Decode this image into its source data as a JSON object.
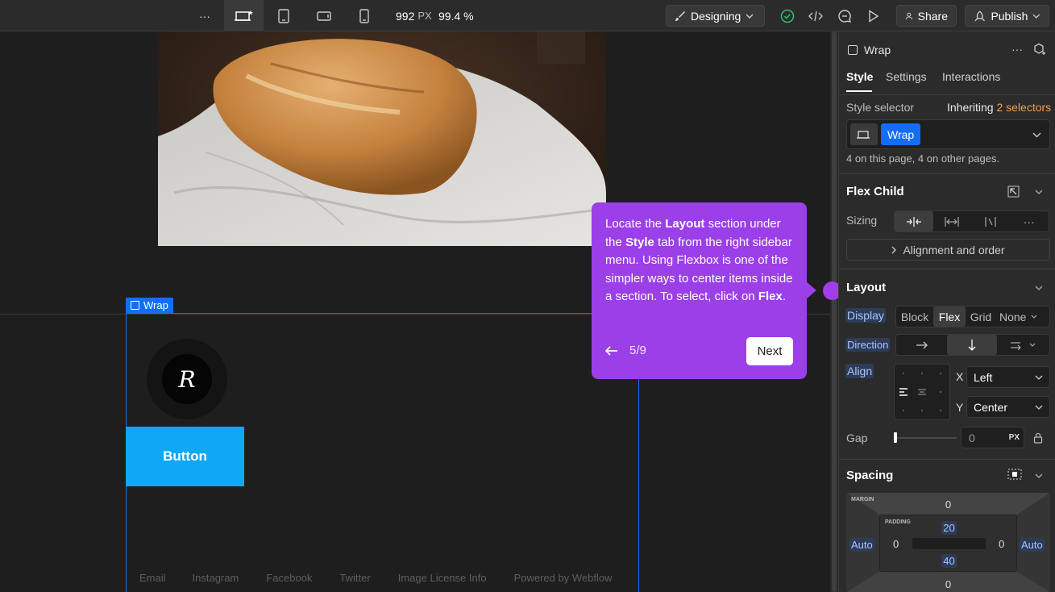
{
  "topbar": {
    "more_label": "···",
    "width_value": "992",
    "width_unit": "PX",
    "zoom": "99.4 %",
    "mode_label": "Designing",
    "share_label": "Share",
    "publish_label": "Publish"
  },
  "canvas": {
    "wrap_tag": "Wrap",
    "logo_letter": "R",
    "button_label": "Button",
    "footer_links": [
      "Email",
      "Instagram",
      "Facebook",
      "Twitter",
      "Image License Info",
      "Powered by Webflow"
    ]
  },
  "tooltip": {
    "text_parts": [
      {
        "t": "Locate the ",
        "b": false
      },
      {
        "t": "Layout",
        "b": true
      },
      {
        "t": " section under the ",
        "b": false
      },
      {
        "t": "Style",
        "b": true
      },
      {
        "t": " tab from the right sidebar menu. Using Flexbox is one of the simpler ways to center items inside a section. To select, click on ",
        "b": false
      },
      {
        "t": "Flex",
        "b": true
      },
      {
        "t": ".",
        "b": false
      }
    ],
    "step": "5/9",
    "next_label": "Next"
  },
  "panel": {
    "element_name": "Wrap",
    "tabs": [
      "Style",
      "Settings",
      "Interactions"
    ],
    "style_selector_label": "Style selector",
    "inheriting_label": "Inheriting",
    "inheriting_count": "2 selectors",
    "selector_chip": "Wrap",
    "usage_note": "4 on this page, 4 on other pages.",
    "flex_child": {
      "title": "Flex Child",
      "sizing_label": "Sizing",
      "alignment_label": "Alignment and order"
    },
    "layout": {
      "title": "Layout",
      "display_label": "Display",
      "display_options": [
        "Block",
        "Flex",
        "Grid",
        "None"
      ],
      "direction_label": "Direction",
      "align_label": "Align",
      "x_label": "X",
      "x_value": "Left",
      "y_label": "Y",
      "y_value": "Center",
      "gap_label": "Gap",
      "gap_value": "0",
      "gap_unit": "PX"
    },
    "spacing": {
      "title": "Spacing",
      "margin_label": "MARGIN",
      "padding_label": "PADDING",
      "margin_top": "0",
      "margin_left": "Auto",
      "margin_right": "Auto",
      "margin_bottom": "0",
      "padding_top": "20",
      "padding_left": "0",
      "padding_right": "0",
      "padding_bottom": "40"
    }
  },
  "colors": {
    "accent_blue": "#146ef5",
    "tooltip_purple": "#9b3fe8",
    "button_cyan": "#0ea8f5",
    "selector_orange": "#f59e4a"
  }
}
